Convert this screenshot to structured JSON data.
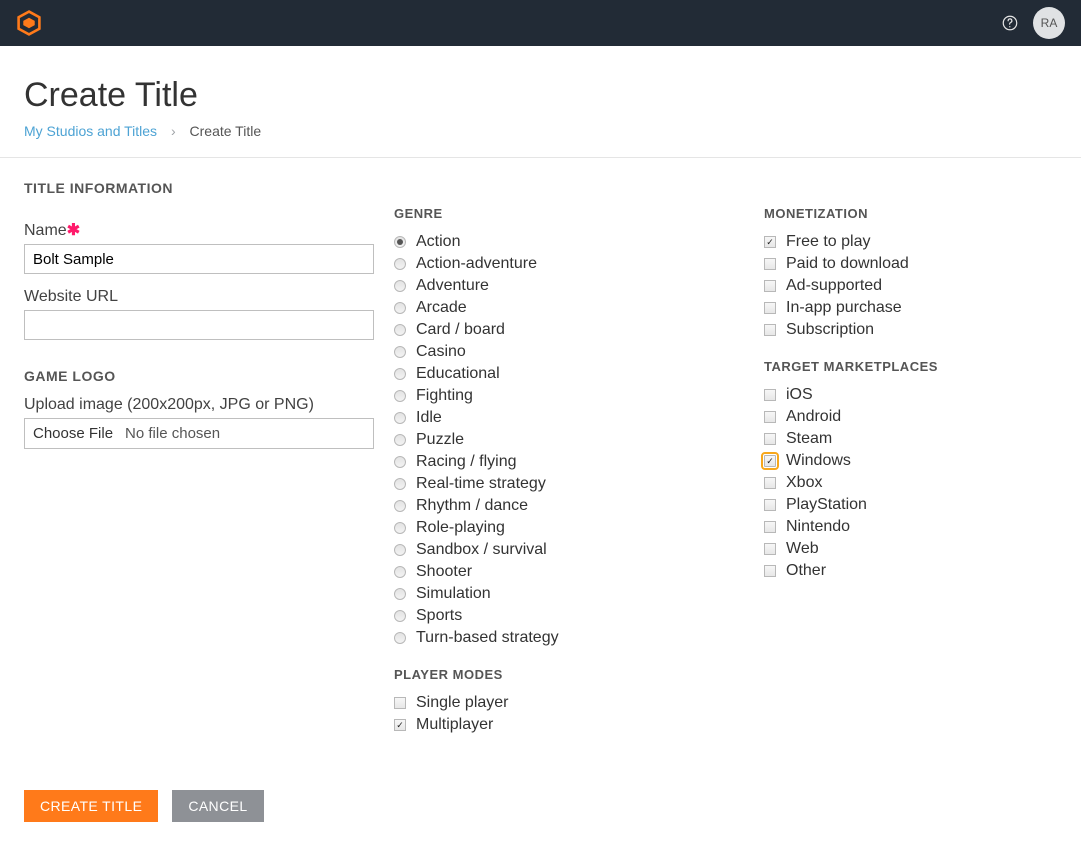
{
  "topbar": {
    "avatar_initials": "RA"
  },
  "page": {
    "title": "Create Title",
    "breadcrumb": {
      "parent": "My Studios and Titles",
      "current": "Create Title"
    },
    "section_title": "TITLE INFORMATION"
  },
  "form": {
    "name": {
      "label": "Name",
      "required": true,
      "value": "Bolt Sample"
    },
    "website": {
      "label": "Website URL",
      "value": ""
    },
    "game_logo": {
      "heading": "GAME LOGO",
      "upload_label": "Upload image (200x200px, JPG or PNG)",
      "button_label": "Choose File",
      "status": "No file chosen"
    }
  },
  "genre": {
    "heading": "GENRE",
    "options": [
      {
        "label": "Action",
        "selected": true
      },
      {
        "label": "Action-adventure",
        "selected": false
      },
      {
        "label": "Adventure",
        "selected": false
      },
      {
        "label": "Arcade",
        "selected": false
      },
      {
        "label": "Card / board",
        "selected": false
      },
      {
        "label": "Casino",
        "selected": false
      },
      {
        "label": "Educational",
        "selected": false
      },
      {
        "label": "Fighting",
        "selected": false
      },
      {
        "label": "Idle",
        "selected": false
      },
      {
        "label": "Puzzle",
        "selected": false
      },
      {
        "label": "Racing / flying",
        "selected": false
      },
      {
        "label": "Real-time strategy",
        "selected": false
      },
      {
        "label": "Rhythm / dance",
        "selected": false
      },
      {
        "label": "Role-playing",
        "selected": false
      },
      {
        "label": "Sandbox / survival",
        "selected": false
      },
      {
        "label": "Shooter",
        "selected": false
      },
      {
        "label": "Simulation",
        "selected": false
      },
      {
        "label": "Sports",
        "selected": false
      },
      {
        "label": "Turn-based strategy",
        "selected": false
      }
    ]
  },
  "player_modes": {
    "heading": "PLAYER MODES",
    "options": [
      {
        "label": "Single player",
        "selected": false
      },
      {
        "label": "Multiplayer",
        "selected": true
      }
    ]
  },
  "monetization": {
    "heading": "MONETIZATION",
    "options": [
      {
        "label": "Free to play",
        "selected": true
      },
      {
        "label": "Paid to download",
        "selected": false
      },
      {
        "label": "Ad-supported",
        "selected": false
      },
      {
        "label": "In-app purchase",
        "selected": false
      },
      {
        "label": "Subscription",
        "selected": false
      }
    ]
  },
  "marketplaces": {
    "heading": "TARGET MARKETPLACES",
    "options": [
      {
        "label": "iOS",
        "selected": false,
        "highlight": false
      },
      {
        "label": "Android",
        "selected": false,
        "highlight": false
      },
      {
        "label": "Steam",
        "selected": false,
        "highlight": false
      },
      {
        "label": "Windows",
        "selected": true,
        "highlight": true
      },
      {
        "label": "Xbox",
        "selected": false,
        "highlight": false
      },
      {
        "label": "PlayStation",
        "selected": false,
        "highlight": false
      },
      {
        "label": "Nintendo",
        "selected": false,
        "highlight": false
      },
      {
        "label": "Web",
        "selected": false,
        "highlight": false
      },
      {
        "label": "Other",
        "selected": false,
        "highlight": false
      }
    ]
  },
  "buttons": {
    "create": "CREATE TITLE",
    "cancel": "CANCEL"
  }
}
